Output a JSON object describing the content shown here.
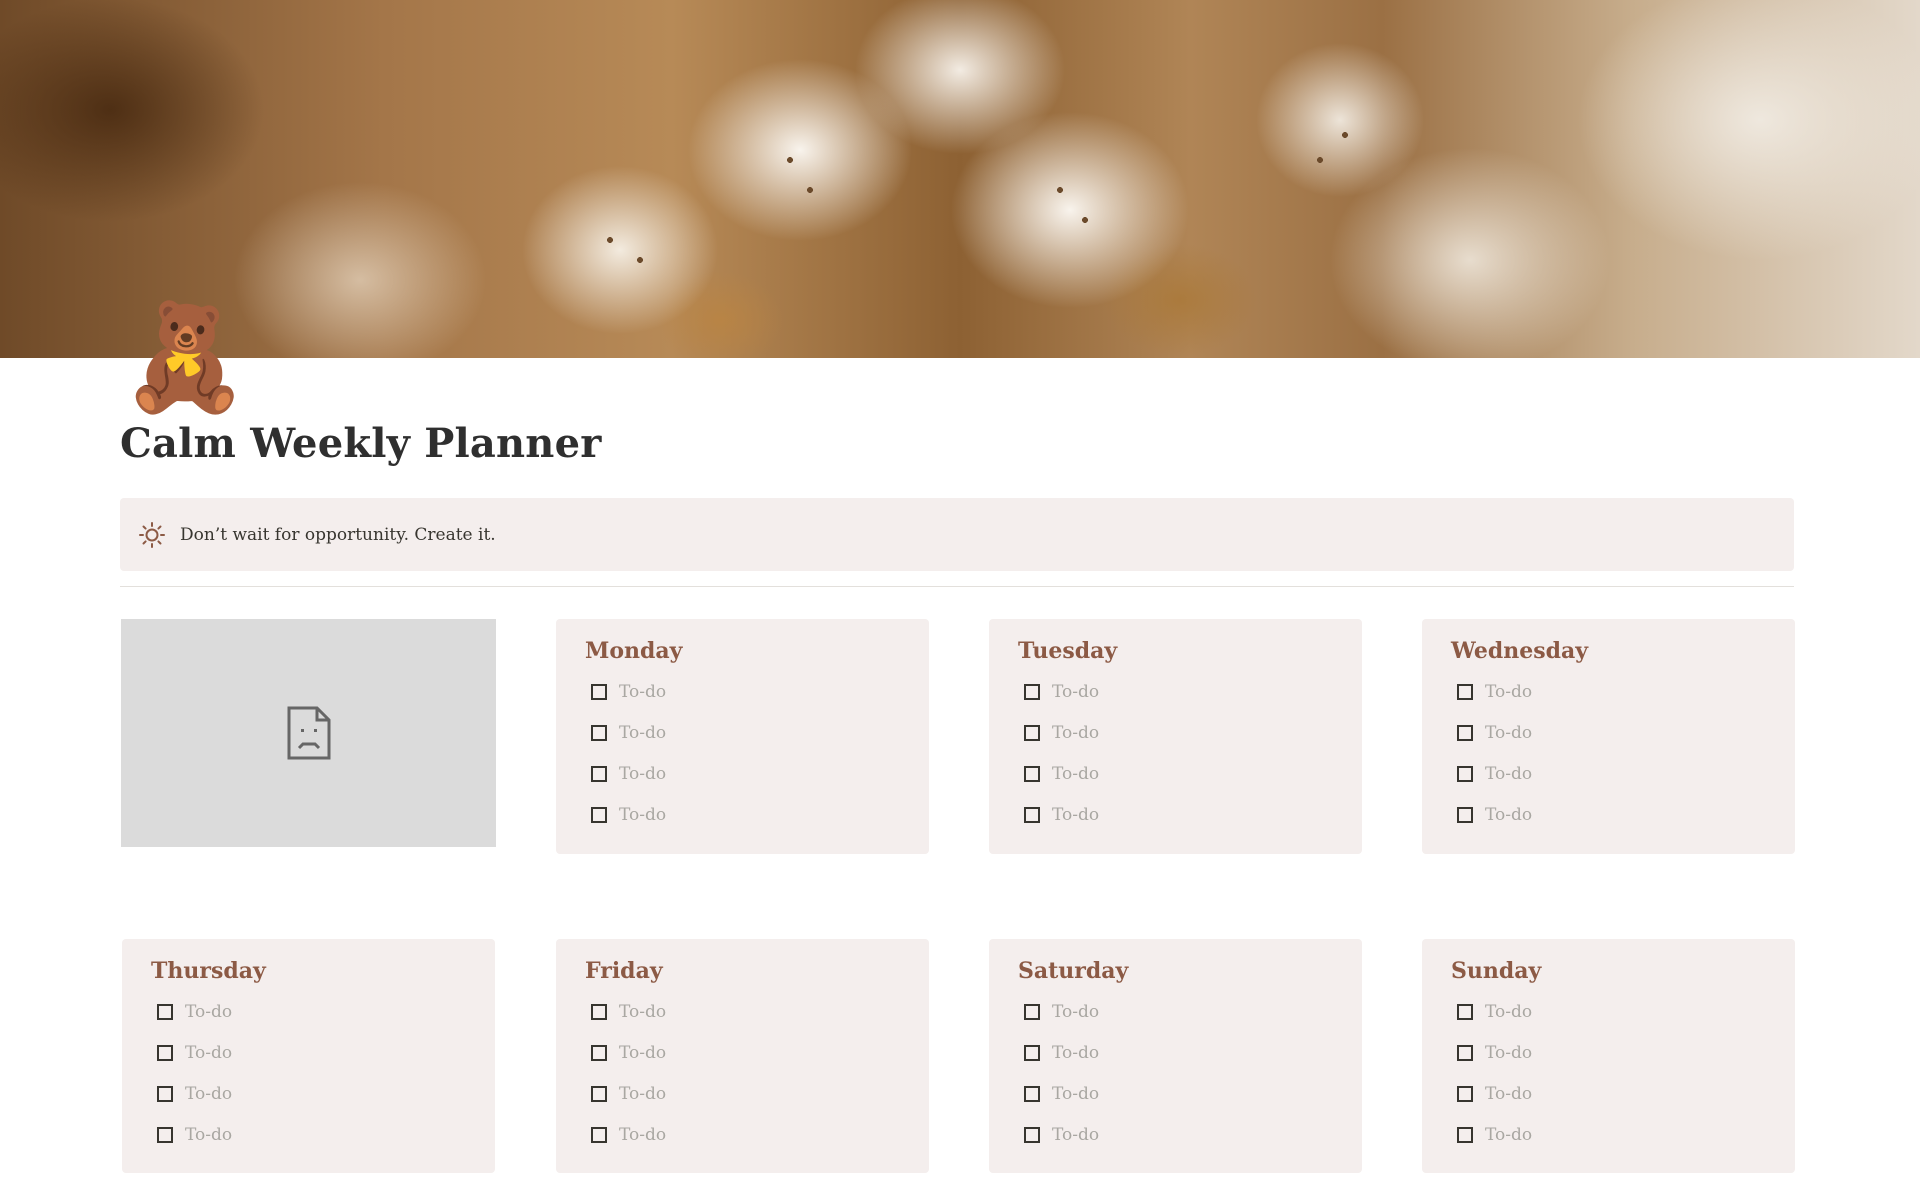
{
  "page": {
    "icon": "🧸",
    "icon_name": "teddy-bear-icon",
    "title": "Calm Weekly Planner"
  },
  "callout": {
    "icon_name": "sun-icon",
    "text": "Don’t wait for opportunity. Create it."
  },
  "image_placeholder": {
    "icon_name": "broken-image-icon"
  },
  "colors": {
    "card_bg": "#f4eeed",
    "day_title": "#8c5a45",
    "placeholder_text": "#a9a7a2",
    "callout_icon": "#8c5a45"
  },
  "days": [
    {
      "name": "Monday",
      "todos": [
        "To-do",
        "To-do",
        "To-do",
        "To-do"
      ]
    },
    {
      "name": "Tuesday",
      "todos": [
        "To-do",
        "To-do",
        "To-do",
        "To-do"
      ]
    },
    {
      "name": "Wednesday",
      "todos": [
        "To-do",
        "To-do",
        "To-do",
        "To-do"
      ]
    },
    {
      "name": "Thursday",
      "todos": [
        "To-do",
        "To-do",
        "To-do",
        "To-do"
      ]
    },
    {
      "name": "Friday",
      "todos": [
        "To-do",
        "To-do",
        "To-do",
        "To-do"
      ]
    },
    {
      "name": "Saturday",
      "todos": [
        "To-do",
        "To-do",
        "To-do",
        "To-do"
      ]
    },
    {
      "name": "Sunday",
      "todos": [
        "To-do",
        "To-do",
        "To-do",
        "To-do"
      ]
    }
  ]
}
